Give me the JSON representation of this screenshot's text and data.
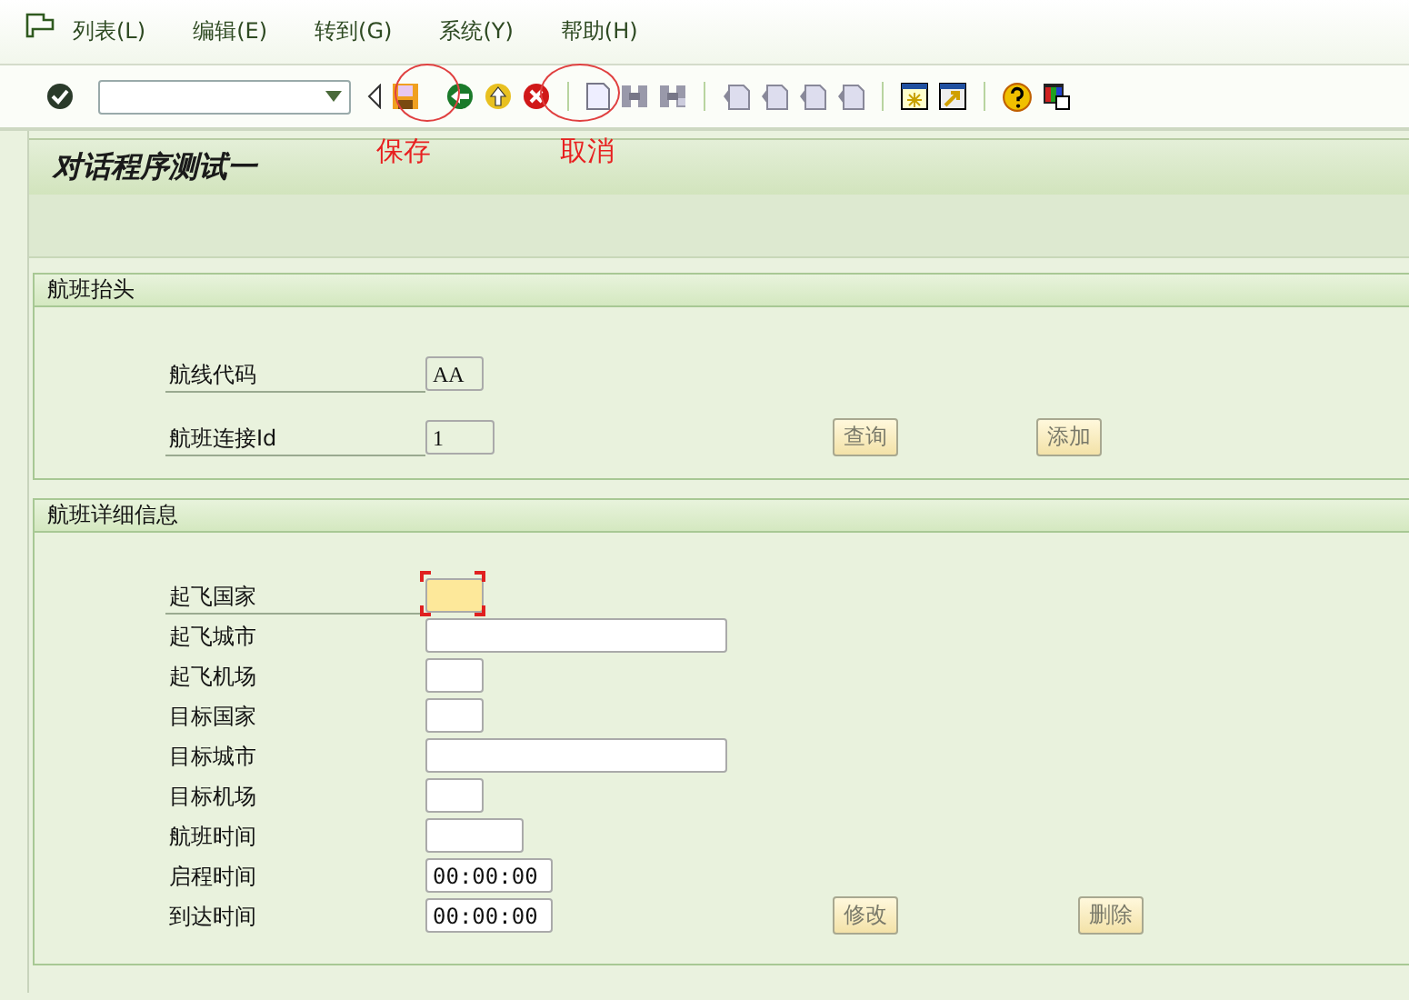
{
  "menu": [
    {
      "label": "列表(L)"
    },
    {
      "label": "编辑(E)"
    },
    {
      "label": "转到(G)"
    },
    {
      "label": "系统(Y)"
    },
    {
      "label": "帮助(H)"
    }
  ],
  "annotations": [
    {
      "text": "保存"
    },
    {
      "text": "取消"
    }
  ],
  "title": "对话程序测试一",
  "sections": [
    {
      "title": "航班抬头",
      "fields": [
        {
          "label": "航线代码",
          "value": "AA",
          "kind": "s",
          "readonly": true,
          "required": false,
          "underlined": true
        },
        {
          "label": "航班连接Id",
          "value": "1",
          "kind": "m",
          "readonly": true,
          "required": false,
          "underlined": true,
          "buttons": [
            "查询",
            "添加"
          ]
        }
      ]
    },
    {
      "title": "航班详细信息",
      "fields": [
        {
          "label": "起飞国家",
          "kind": "s",
          "readonly": false,
          "required": true,
          "underlined": true
        },
        {
          "label": "起飞城市",
          "kind": "l",
          "readonly": false,
          "required": false,
          "underlined": false
        },
        {
          "label": "起飞机场",
          "kind": "s",
          "readonly": false,
          "required": false,
          "underlined": false
        },
        {
          "label": "目标国家",
          "kind": "s",
          "readonly": false,
          "required": false,
          "underlined": false
        },
        {
          "label": "目标城市",
          "kind": "l",
          "readonly": false,
          "required": false,
          "underlined": false
        },
        {
          "label": "目标机场",
          "kind": "s",
          "readonly": false,
          "required": false,
          "underlined": false
        },
        {
          "label": "航班时间",
          "kind": "m",
          "readonly": false,
          "required": false,
          "underlined": false
        },
        {
          "label": "启程时间",
          "value": "00:00:00",
          "kind": "t",
          "readonly": false,
          "required": false,
          "underlined": false
        },
        {
          "label": "到达时间",
          "value": "00:00:00",
          "kind": "t",
          "readonly": false,
          "required": false,
          "underlined": false,
          "buttons": [
            "修改",
            "删除"
          ]
        }
      ]
    }
  ]
}
